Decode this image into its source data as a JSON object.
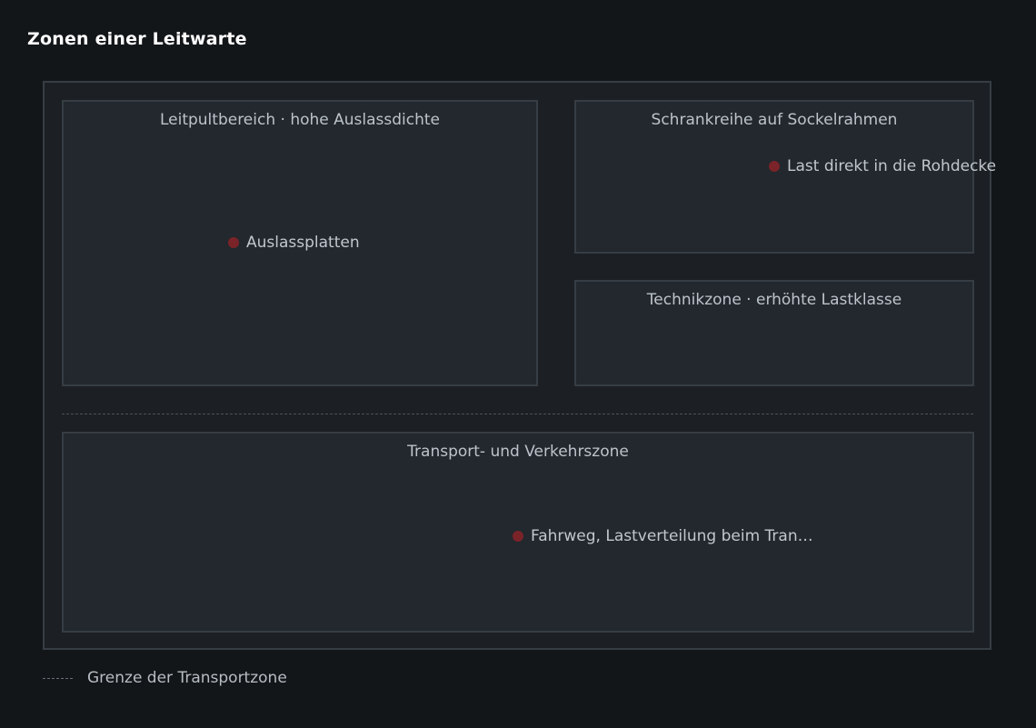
{
  "title": "Zonen einer Leitwarte",
  "zones": {
    "leitpult": {
      "label": "Leitpultbereich · hohe Auslassdichte",
      "marker": "Auslassplatten"
    },
    "schrankreihe": {
      "label": "Schrankreihe auf Sockelrahmen",
      "marker": "Last direkt in die Rohdecke"
    },
    "technik": {
      "label": "Technikzone · erhöhte Lastklasse"
    },
    "transport": {
      "label": "Transport- und Verkehrszone",
      "marker": "Fahrweg, Lastverteilung beim Tran…"
    }
  },
  "legend": {
    "boundary_label": "Grenze der Transportzone"
  },
  "colors": {
    "background": "#131619",
    "zone_fill": "#22282d",
    "zone_border": "#363d44",
    "marker": "#7a2329"
  }
}
